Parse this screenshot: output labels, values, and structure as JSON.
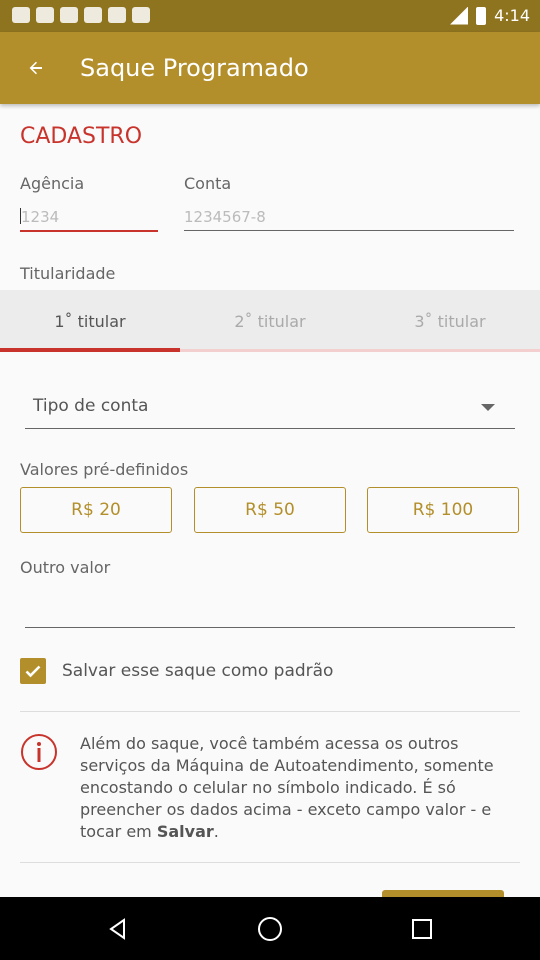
{
  "status_bar": {
    "time": "4:14"
  },
  "app_bar": {
    "title": "Saque Programado"
  },
  "form": {
    "section_title": "CADASTRO",
    "agencia": {
      "label": "Agência",
      "placeholder": "1234"
    },
    "conta": {
      "label": "Conta",
      "placeholder": "1234567-8"
    },
    "titularidade": {
      "label": "Titularidade",
      "tabs": [
        "1˚ titular",
        "2˚ titular",
        "3˚ titular"
      ],
      "selected_index": 0
    },
    "tipo_conta": {
      "label": "Tipo de conta"
    },
    "valores": {
      "label": "Valores pré-definidos",
      "options": [
        "R$ 20",
        "R$ 50",
        "R$ 100"
      ]
    },
    "outro_valor": {
      "label": "Outro valor",
      "value": ""
    },
    "salvar_padrao": {
      "label": "Salvar esse saque como padrão",
      "checked": true
    }
  },
  "info": {
    "text_prefix": "Além do saque, você também acessa os outros serviços da Máquina de Autoatendimento, somente encostando o celular no símbolo indicado. É só preencher os dados acima - exceto campo valor - e tocar em ",
    "text_bold": "Salvar",
    "text_suffix": "."
  },
  "colors": {
    "status_bar": "#8f7420",
    "app_bar": "#b38f2b",
    "accent": "#c8342c",
    "gold": "#b38f2b"
  }
}
